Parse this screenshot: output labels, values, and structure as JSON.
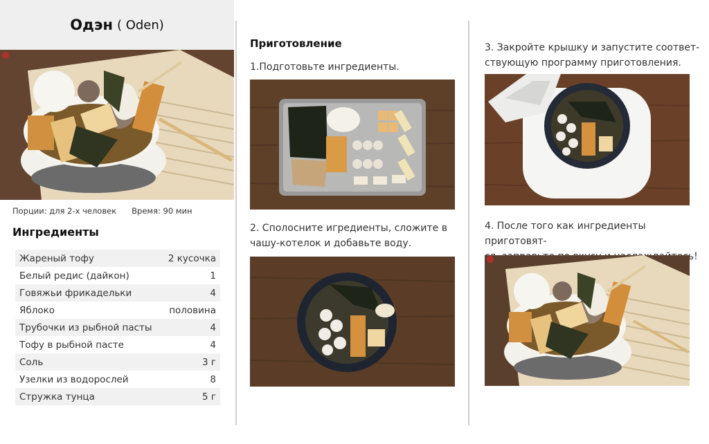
{
  "recipe": {
    "title": "Одэн",
    "subtitle": "( Oden)",
    "servings": "Порции: для 2-х человек",
    "time": "Время: 90 мин",
    "ingredients_heading": "Ингредиенты",
    "ingredients": [
      {
        "name": "Жареный тофу",
        "qty": "2 кусочка"
      },
      {
        "name": "Белый редис (дайкон)",
        "qty": "1"
      },
      {
        "name": "Говяжьи фрикадельки",
        "qty": "4"
      },
      {
        "name": "Яблоко",
        "qty": "половина"
      },
      {
        "name": "Трубочки из рыбной пасты",
        "qty": "4"
      },
      {
        "name": "Тофу в рыбной пасте",
        "qty": "4"
      },
      {
        "name": "Соль",
        "qty": "3 г"
      },
      {
        "name": "Узелки из водорослей",
        "qty": "8"
      },
      {
        "name": "Стружка тунца",
        "qty": "5 г"
      }
    ]
  },
  "preparation": {
    "heading": "Приготовление",
    "steps": [
      {
        "line1": "1.Подготовьте ингредиенты.",
        "line2": ""
      },
      {
        "line1": "2. Сполосните игредиенты, сложите в",
        "line2": "чашу-котелок и добавьте воду."
      },
      {
        "line1": "3. Закройте крышку и запустите соответ-",
        "line2": "ствующую программу приготовления."
      },
      {
        "line1": "4. После того как ингредиенты приготовят-",
        "line2": "ся, заправьте по вкусу и наслаждайтесь!"
      }
    ]
  }
}
